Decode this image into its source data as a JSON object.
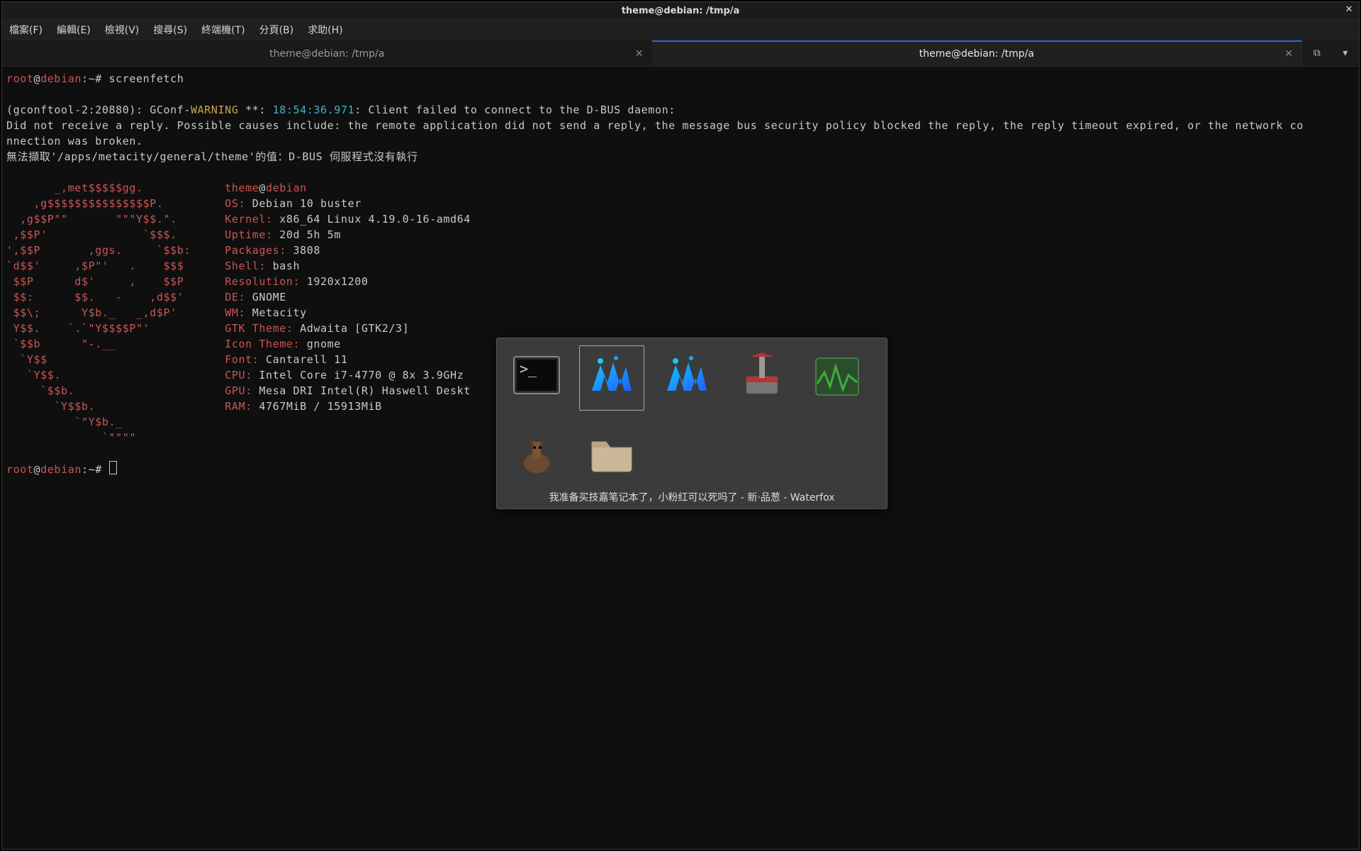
{
  "titlebar": {
    "title": "theme@debian: /tmp/a"
  },
  "menu": {
    "file": "檔案(F)",
    "edit": "編輯(E)",
    "view": "檢視(V)",
    "search": "搜尋(S)",
    "terminal": "終端機(T)",
    "tabs": "分頁(B)",
    "help": "求助(H)"
  },
  "tabs": {
    "left": "theme@debian: /tmp/a",
    "right": "theme@debian: /tmp/a"
  },
  "term": {
    "prompt_user": "root",
    "prompt_at": "@",
    "prompt_host": "debian",
    "prompt_path1": ":~#",
    "cmd": " screenfetch",
    "err_head": "(gconftool-2:20880): GConf-",
    "err_warn": "WARNING",
    "err_mid": " **: ",
    "err_time": "18:54:36.971",
    "err_tail": ": Client failed to connect to the D-BUS daemon:",
    "err2": "Did not receive a reply. Possible causes include: the remote application did not send a reply, the message bus security policy blocked the reply, the reply timeout expired, or the network co",
    "err3": "nnection was broken.",
    "err4": "無法擷取'/apps/metacity/general/theme'的值：D-BUS 伺服程式沒有執行",
    "ascii": [
      "       _,met$$$$$gg.",
      "    ,g$$$$$$$$$$$$$$$P.",
      "  ,g$$P\"\"       \"\"\"Y$$.\".",
      " ,$$P'              `$$$.",
      "',$$P       ,ggs.     `$$b:",
      "`d$$'     ,$P\"'   .    $$$",
      " $$P      d$'     ,    $$P",
      " $$:      $$.   -    ,d$$'",
      " $$\\;      Y$b._   _,d$P'",
      " Y$$.    `.`\"Y$$$$P\"'",
      " `$$b      \"-.__",
      "  `Y$$",
      "   `Y$$.",
      "     `$$b.",
      "       `Y$$b.",
      "          `\"Y$b._",
      "              `\"\"\"\""
    ],
    "info_user": "theme",
    "info_host": "debian",
    "labels": {
      "os": "OS:",
      "kernel": "Kernel:",
      "uptime": "Uptime:",
      "packages": "Packages:",
      "shell": "Shell:",
      "resolution": "Resolution:",
      "de": "DE:",
      "wm": "WM:",
      "gtk": "GTK Theme:",
      "icon": "Icon Theme:",
      "font": "Font:",
      "cpu": "CPU:",
      "gpu": "GPU:",
      "ram": "RAM:"
    },
    "values": {
      "os": "Debian 10 buster",
      "kernel": "x86_64 Linux 4.19.0-16-amd64",
      "uptime": "20d 5h 5m",
      "packages": "3808",
      "shell": "bash",
      "resolution": "1920x1200",
      "de": "GNOME",
      "wm": "Metacity",
      "gtk": "Adwaita [GTK2/3]",
      "icon": "gnome",
      "font": "Cantarell 11",
      "cpu": "Intel Core i7-4770 @ 8x 3.9GHz",
      "gpu": "Mesa DRI Intel(R) Haswell Deskt",
      "ram": "4767MiB / 15913MiB"
    },
    "prompt2_user": "root",
    "prompt2_host": "debian",
    "prompt2_path": ":~#"
  },
  "switcher": {
    "caption": "我准备买技嘉笔记本了，小粉红可以死吗了 - 新·品葱 - Waterfox",
    "items": [
      {
        "name": "terminal"
      },
      {
        "name": "waterfox",
        "selected": true
      },
      {
        "name": "waterfox"
      },
      {
        "name": "transmission"
      },
      {
        "name": "system-monitor"
      },
      {
        "name": "amule"
      },
      {
        "name": "folder"
      }
    ]
  }
}
